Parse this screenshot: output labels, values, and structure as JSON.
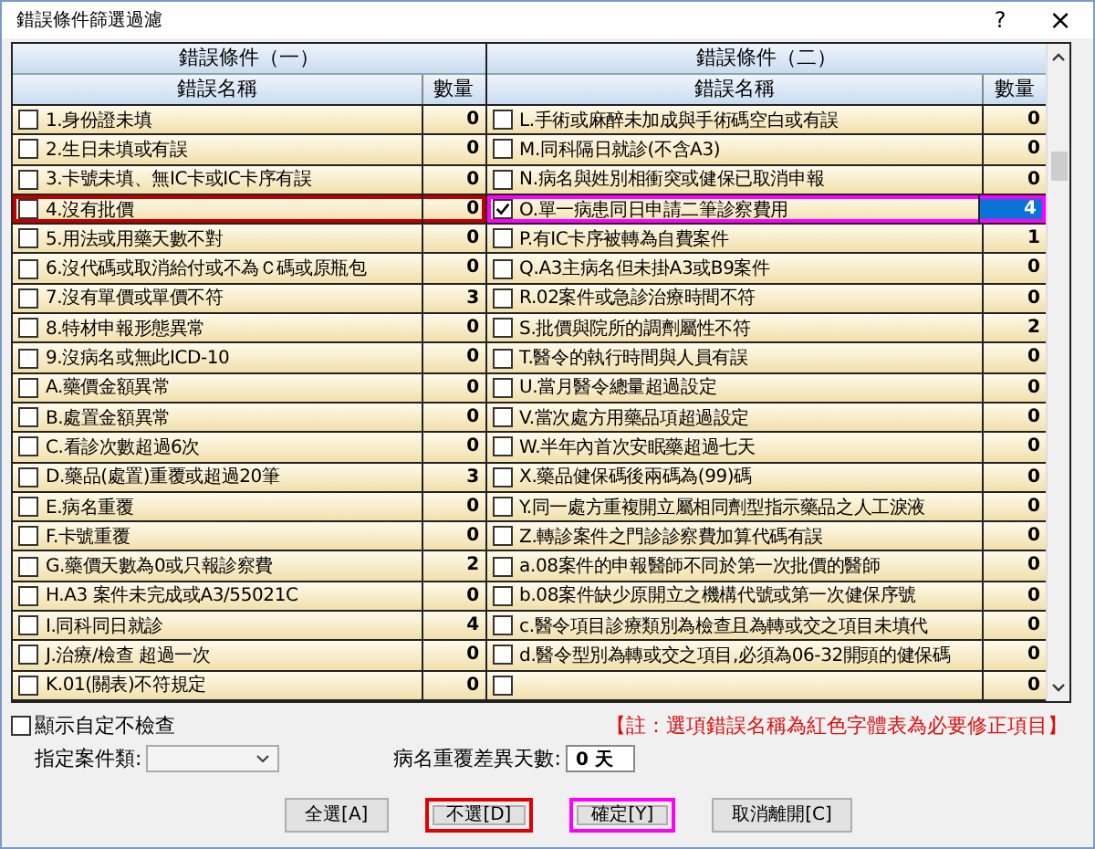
{
  "window": {
    "title": "錯誤條件篩選過濾",
    "help": "?",
    "close": "×"
  },
  "groups": [
    {
      "title": "錯誤條件（一）",
      "name_header": "錯誤名稱",
      "count_header": "數量",
      "rows": [
        {
          "name": "1.身份證未填",
          "count": "0",
          "checked": false,
          "selected": false
        },
        {
          "name": "2.生日未填或有誤",
          "count": "0",
          "checked": false,
          "selected": false
        },
        {
          "name": "3.卡號未填、無IC卡或IC卡序有誤",
          "count": "0",
          "checked": false,
          "selected": false
        },
        {
          "name": "4.沒有批價",
          "count": "0",
          "checked": false,
          "selected": false,
          "color": "#c00000"
        },
        {
          "name": "5.用法或用藥天數不對",
          "count": "0",
          "checked": false,
          "selected": false
        },
        {
          "name": "6.沒代碼或取消給付或不為Ｃ碼或原瓶包",
          "count": "0",
          "checked": false,
          "selected": false
        },
        {
          "name": "7.沒有單價或單價不符",
          "count": "3",
          "checked": false,
          "selected": false
        },
        {
          "name": "8.特材申報形態異常",
          "count": "0",
          "checked": false,
          "selected": false
        },
        {
          "name": "9.沒病名或無此ICD-10",
          "count": "0",
          "checked": false,
          "selected": false
        },
        {
          "name": "A.藥價金額異常",
          "count": "0",
          "checked": false,
          "selected": false
        },
        {
          "name": "B.處置金額異常",
          "count": "0",
          "checked": false,
          "selected": false
        },
        {
          "name": "C.看診次數超過6次",
          "count": "0",
          "checked": false,
          "selected": false
        },
        {
          "name": "D.藥品(處置)重覆或超過20筆",
          "count": "3",
          "checked": false,
          "selected": false
        },
        {
          "name": "E.病名重覆",
          "count": "0",
          "checked": false,
          "selected": false
        },
        {
          "name": "F.卡號重覆",
          "count": "0",
          "checked": false,
          "selected": false
        },
        {
          "name": "G.藥價天數為0或只報診察費",
          "count": "2",
          "checked": false,
          "selected": false
        },
        {
          "name": "H.A3 案件未完成或A3/55021C",
          "count": "0",
          "checked": false,
          "selected": false
        },
        {
          "name": "I.同科同日就診",
          "count": "4",
          "checked": false,
          "selected": false
        },
        {
          "name": "J.治療/檢查 超過一次",
          "count": "0",
          "checked": false,
          "selected": false
        },
        {
          "name": "K.01(關表)不符規定",
          "count": "0",
          "checked": false,
          "selected": false
        }
      ]
    },
    {
      "title": "錯誤條件（二）",
      "name_header": "錯誤名稱",
      "count_header": "數量",
      "rows": [
        {
          "name": "L.手術或麻醉未加成與手術碼空白或有誤",
          "count": "0",
          "checked": false,
          "selected": false
        },
        {
          "name": "M.同科隔日就診(不含A3)",
          "count": "0",
          "checked": false,
          "selected": false
        },
        {
          "name": "N.病名與姓別相衝突或健保已取消申報",
          "count": "0",
          "checked": false,
          "selected": false
        },
        {
          "name": "O.單一病患同日申請二筆診察費用",
          "count": "4",
          "checked": true,
          "selected": true,
          "color": "#ff00ff"
        },
        {
          "name": "P.有IC卡序被轉為自費案件",
          "count": "1",
          "checked": false,
          "selected": false
        },
        {
          "name": "Q.A3主病名但未掛A3或B9案件",
          "count": "0",
          "checked": false,
          "selected": false
        },
        {
          "name": "R.02案件或急診治療時間不符",
          "count": "0",
          "checked": false,
          "selected": false
        },
        {
          "name": "S.批價與院所的調劑屬性不符",
          "count": "2",
          "checked": false,
          "selected": false
        },
        {
          "name": "T.醫令的執行時間與人員有誤",
          "count": "0",
          "checked": false,
          "selected": false
        },
        {
          "name": "U.當月醫令總量超過設定",
          "count": "0",
          "checked": false,
          "selected": false
        },
        {
          "name": "V.當次處方用藥品項超過設定",
          "count": "0",
          "checked": false,
          "selected": false
        },
        {
          "name": "W.半年內首次安眠藥超過七天",
          "count": "0",
          "checked": false,
          "selected": false
        },
        {
          "name": "X.藥品健保碼後兩碼為(99)碼",
          "count": "0",
          "checked": false,
          "selected": false
        },
        {
          "name": "Y.同一處方重複開立屬相同劑型指示藥品之人工淚液",
          "count": "0",
          "checked": false,
          "selected": false
        },
        {
          "name": "Z.轉診案件之門診診察費加算代碼有誤",
          "count": "0",
          "checked": false,
          "selected": false
        },
        {
          "name": "a.08案件的申報醫師不同於第一次批價的醫師",
          "count": "0",
          "checked": false,
          "selected": false
        },
        {
          "name": "b.08案件缺少原開立之機構代號或第一次健保序號",
          "count": "0",
          "checked": false,
          "selected": false
        },
        {
          "name": "c.醫令項目診療類別為檢查且為轉或交之項目未填代",
          "count": "0",
          "checked": false,
          "selected": false
        },
        {
          "name": "d.醫令型別為轉或交之項目,必須為06-32開頭的健保碼",
          "count": "0",
          "checked": false,
          "selected": false
        },
        {
          "count": "0",
          "checked": false,
          "selected": false
        }
      ]
    }
  ],
  "options": {
    "show_custom": {
      "label": "顯示自定不檢查",
      "checked": false
    },
    "note": "【註：選項錯誤名稱為紅色字體表為必要修正項目】",
    "case_type": {
      "label": "指定案件類:"
    },
    "diff_days": {
      "label": "病名重覆差異天數:",
      "value": "0 天"
    }
  },
  "buttons": [
    {
      "label": "全選[A]"
    },
    {
      "label": "不選[D]",
      "color": "#e00000"
    },
    {
      "label": "確定[Y]",
      "color": "#ff00ff"
    },
    {
      "label": "取消離開[C]"
    }
  ]
}
